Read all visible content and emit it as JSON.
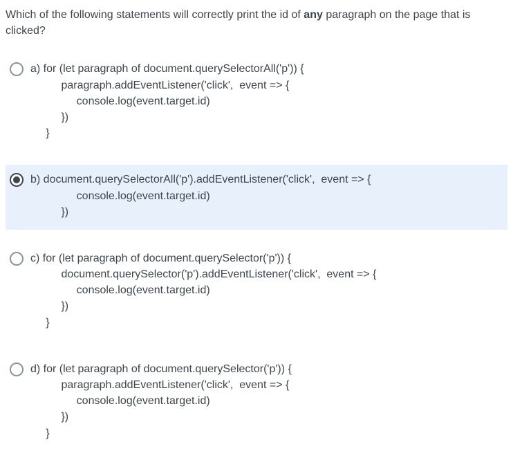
{
  "question": {
    "prefix": "Which of the following statements will correctly print the id of ",
    "emph": "any",
    "suffix": " paragraph on the page that is clicked?"
  },
  "selected_index": 1,
  "options": [
    {
      "letter": "a)",
      "first": "for (let paragraph of document.querySelectorAll('p')) {",
      "rest": "          paragraph.addEventListener('click',  event => {\n               console.log(event.target.id)\n          })\n     }"
    },
    {
      "letter": "b)",
      "first": "document.querySelectorAll('p').addEventListener('click',  event => {",
      "rest": "               console.log(event.target.id)\n          })"
    },
    {
      "letter": "c)",
      "first": "for (let paragraph of document.querySelector('p')) {",
      "rest": "          document.querySelector('p').addEventListener('click',  event => {\n               console.log(event.target.id)\n          })\n     }"
    },
    {
      "letter": "d)",
      "first": "for (let paragraph of document.querySelector('p')) {",
      "rest": "          paragraph.addEventListener('click',  event => {\n               console.log(event.target.id)\n          })\n     }"
    }
  ]
}
